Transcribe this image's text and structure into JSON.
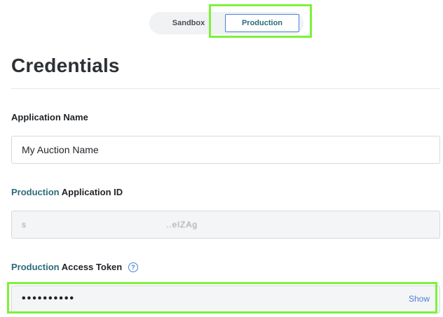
{
  "environment_toggle": {
    "options": [
      "Sandbox",
      "Production"
    ],
    "selected": "Production"
  },
  "page_title": "Credentials",
  "application_name": {
    "label": "Application Name",
    "value": "My Auction Name"
  },
  "application_id": {
    "label_env": "Production",
    "label_rest": "Application ID",
    "masked_fragments": [
      "s",
      "",
      "..elZAg"
    ]
  },
  "access_token": {
    "label_env": "Production",
    "label_rest": "Access Token",
    "help_glyph": "?",
    "help_icon": "question-circle-icon",
    "masked_value": "••••••••••",
    "show_label": "Show"
  },
  "colors": {
    "accent_teal": "#2c6b7a",
    "link_blue": "#4a7fd9",
    "highlight_green": "#7cf23a"
  }
}
